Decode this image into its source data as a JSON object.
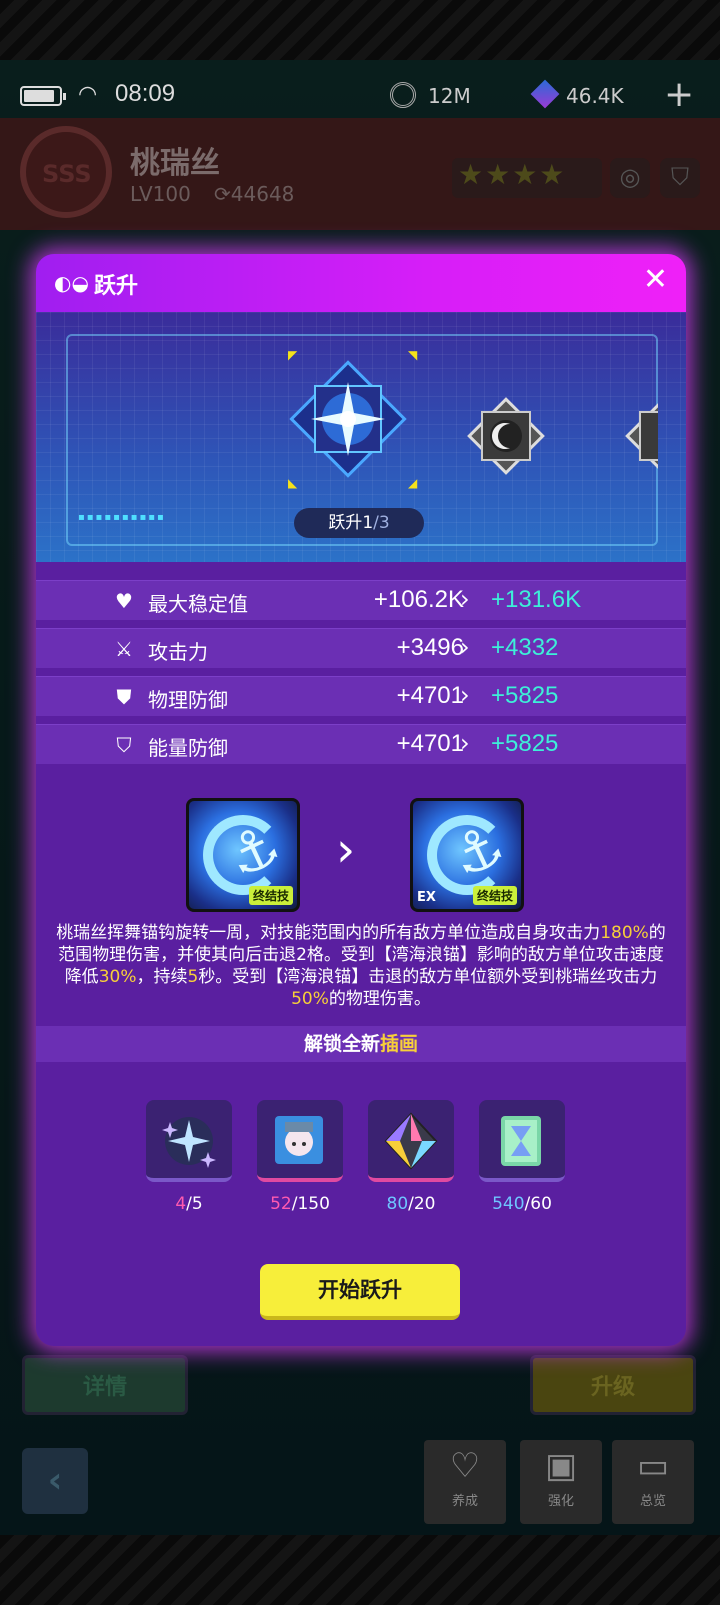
{
  "status_bar": {
    "time": "08:09",
    "currency_1": "12M",
    "currency_2": "46.4K",
    "add_symbol": "+"
  },
  "character": {
    "badge": "SSS",
    "name": "桃瑞丝",
    "level": "LV100",
    "power": "44648",
    "stars": "★★★★"
  },
  "modal": {
    "title": "跃升",
    "close_symbol": "✕",
    "ascension_label": "跃升",
    "ascension_current": "1",
    "ascension_total": "/3",
    "stats": [
      {
        "icon": "heart-icon",
        "name": "最大稳定值",
        "from": "+106.2K",
        "to": "+131.6K"
      },
      {
        "icon": "sword-icon",
        "name": "攻击力",
        "from": "+3496",
        "to": "+4332"
      },
      {
        "icon": "shield-alert-icon",
        "name": "物理防御",
        "from": "+4701",
        "to": "+5825"
      },
      {
        "icon": "shield-bolt-icon",
        "name": "能量防御",
        "from": "+4701",
        "to": "+5825"
      }
    ],
    "skill": {
      "tag": "终结技",
      "ex_tag": "EX"
    },
    "description": {
      "p1": "桃瑞丝挥舞锚钩旋转一周，对技能范围内的所有敌方单位造成自身攻击力",
      "v1": "180%",
      "p2": "的范围物理伤害，并使其向后击退2格。受到【湾海浪锚】影响的敌方单位攻击速度降低",
      "v2": "30%",
      "p3": "，持续",
      "v3": "5",
      "p4": "秒。受到【湾海浪锚】击退的敌方单位额外受到桃瑞丝攻击力",
      "v4": "50%",
      "p5": "的物理伤害。"
    },
    "unlock": {
      "prefix": "解锁全新",
      "highlight": "插画"
    },
    "materials": [
      {
        "icon": "star-cluster-icon",
        "have": "4",
        "need": "/5"
      },
      {
        "icon": "portrait-chip-icon",
        "have": "52",
        "need": "/150"
      },
      {
        "icon": "prism-icon",
        "have": "80",
        "need": "/20"
      },
      {
        "icon": "hourglass-card-icon",
        "have": "540",
        "need": "/60"
      }
    ],
    "start_button": "开始跃升"
  },
  "background_buttons": {
    "details": "详情",
    "upgrade": "升级"
  },
  "bottom_nav": [
    {
      "icon": "heart-icon",
      "label": "养成"
    },
    {
      "icon": "chip-icon",
      "label": "强化"
    },
    {
      "icon": "folder-icon",
      "label": "总览"
    }
  ],
  "colors": {
    "modal_bg": "#5a1fa0",
    "header_magenta": "#f020f8",
    "upgrade_value": "#3df0d8",
    "highlight_yellow": "#f7cf3a",
    "start_button": "#f7ee3a"
  }
}
